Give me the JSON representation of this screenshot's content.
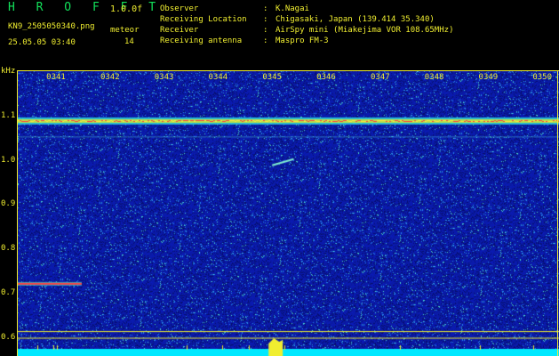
{
  "header": {
    "app_title": "H R O F F T",
    "version": "1.0.0f",
    "filename": "KN9_2505050340.png",
    "datetime": "25.05.05 03:40",
    "meteor_label": "meteor",
    "meteor_count": "14"
  },
  "station": [
    {
      "label": "Observer",
      "sep": ":",
      "value": "K.Nagai"
    },
    {
      "label": "Receiving Location",
      "sep": ":",
      "value": "Chigasaki, Japan (139.414 35.340)"
    },
    {
      "label": "Receiver",
      "sep": ":",
      "value": "AirSpy mini (Miakejima VOR 108.65MHz)"
    },
    {
      "label": "Receiving antenna",
      "sep": ":",
      "value": "Maspro FM-3"
    }
  ],
  "axes": {
    "y_unit": "kHz",
    "y_ticks": [
      {
        "label": "1.1",
        "value": 1.1
      },
      {
        "label": "1.0",
        "value": 1.0
      },
      {
        "label": "0.9",
        "value": 0.9
      },
      {
        "label": "0.8",
        "value": 0.8
      },
      {
        "label": "0.7",
        "value": 0.7
      },
      {
        "label": "0.6",
        "value": 0.6
      }
    ],
    "x_ticks": [
      {
        "label": "0341",
        "minute": 1
      },
      {
        "label": "0342",
        "minute": 2
      },
      {
        "label": "0343",
        "minute": 3
      },
      {
        "label": "0344",
        "minute": 4
      },
      {
        "label": "0345",
        "minute": 5
      },
      {
        "label": "0346",
        "minute": 6
      },
      {
        "label": "0347",
        "minute": 7
      },
      {
        "label": "0348",
        "minute": 8
      },
      {
        "label": "0349",
        "minute": 9
      },
      {
        "label": "0350",
        "minute": 10
      }
    ]
  },
  "colors": {
    "label": "#f0ee30",
    "title": "#12e05a",
    "noise_floor": "#0a1a9a",
    "carrier": "#ff4040",
    "baseline": "#00e8ff"
  }
}
